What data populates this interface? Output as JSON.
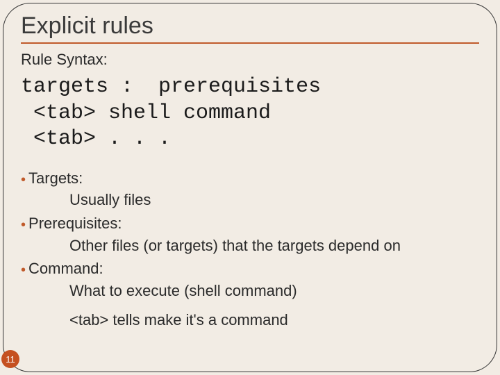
{
  "title": "Explicit rules",
  "subtitle": "Rule Syntax:",
  "code": {
    "line1": "targets :  prerequisites",
    "line2": " <tab> shell command",
    "line3": " <tab> . . ."
  },
  "bullets": {
    "b1_label": "Targets:",
    "b1_text": "Usually files",
    "b2_label": " Prerequisites:",
    "b2_text": "Other files (or targets) that the targets depend on",
    "b3_label": " Command:",
    "b3_text": "What to execute (shell command)"
  },
  "note": "<tab> tells make it's a command",
  "page_number": "11"
}
